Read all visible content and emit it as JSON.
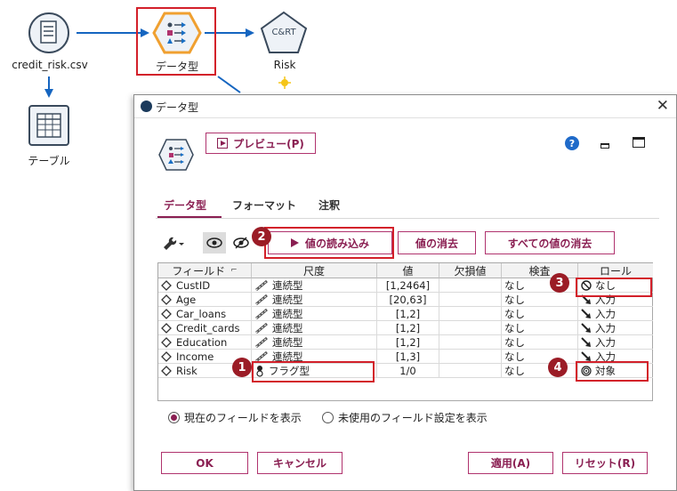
{
  "canvas": {
    "source_node": {
      "label": "credit_risk.csv"
    },
    "type_node": {
      "label": "データ型"
    },
    "model_node": {
      "label": "Risk",
      "icon_text": "C&RT"
    },
    "table_node": {
      "label": "テーブル"
    }
  },
  "dialog": {
    "title": "データ型",
    "preview_label": "プレビュー(P)",
    "tabs": [
      "データ型",
      "フォーマット",
      "注釈"
    ],
    "toolbar": {
      "read_values": "値の読み込み",
      "clear_values": "値の消去",
      "clear_all_values": "すべての値の消去"
    },
    "table": {
      "columns": [
        "フィールド",
        "尺度",
        "値",
        "欠損値",
        "検査",
        "ロール"
      ],
      "rows": [
        {
          "field": "CustID",
          "measure": "連続型",
          "values": "[1,2464]",
          "missing": "",
          "check": "なし",
          "role": "なし"
        },
        {
          "field": "Age",
          "measure": "連続型",
          "values": "[20,63]",
          "missing": "",
          "check": "なし",
          "role": "入力"
        },
        {
          "field": "Car_loans",
          "measure": "連続型",
          "values": "[1,2]",
          "missing": "",
          "check": "なし",
          "role": "入力"
        },
        {
          "field": "Credit_cards",
          "measure": "連続型",
          "values": "[1,2]",
          "missing": "",
          "check": "なし",
          "role": "入力"
        },
        {
          "field": "Education",
          "measure": "連続型",
          "values": "[1,2]",
          "missing": "",
          "check": "なし",
          "role": "入力"
        },
        {
          "field": "Income",
          "measure": "連続型",
          "values": "[1,3]",
          "missing": "",
          "check": "なし",
          "role": "入力"
        },
        {
          "field": "Risk",
          "measure": "フラグ型",
          "values": "1/0",
          "missing": "",
          "check": "なし",
          "role": "対象"
        }
      ]
    },
    "view_options": {
      "current_fields": "現在のフィールドを表示",
      "unused_fields": "未使用のフィールド設定を表示",
      "selected": "current_fields"
    },
    "buttons": {
      "ok": "OK",
      "cancel": "キャンセル",
      "apply": "適用(A)",
      "reset": "リセット(R)"
    },
    "help_icon_text": "?"
  },
  "callouts": [
    "1",
    "2",
    "3",
    "4"
  ],
  "colors": {
    "accent": "#8a1f52",
    "callout": "#9b1c26",
    "highlight_box": "#d3202a",
    "node_orange": "#f0a030",
    "node_blue": "#1a6fc4",
    "link_blue": "#1565c0"
  }
}
